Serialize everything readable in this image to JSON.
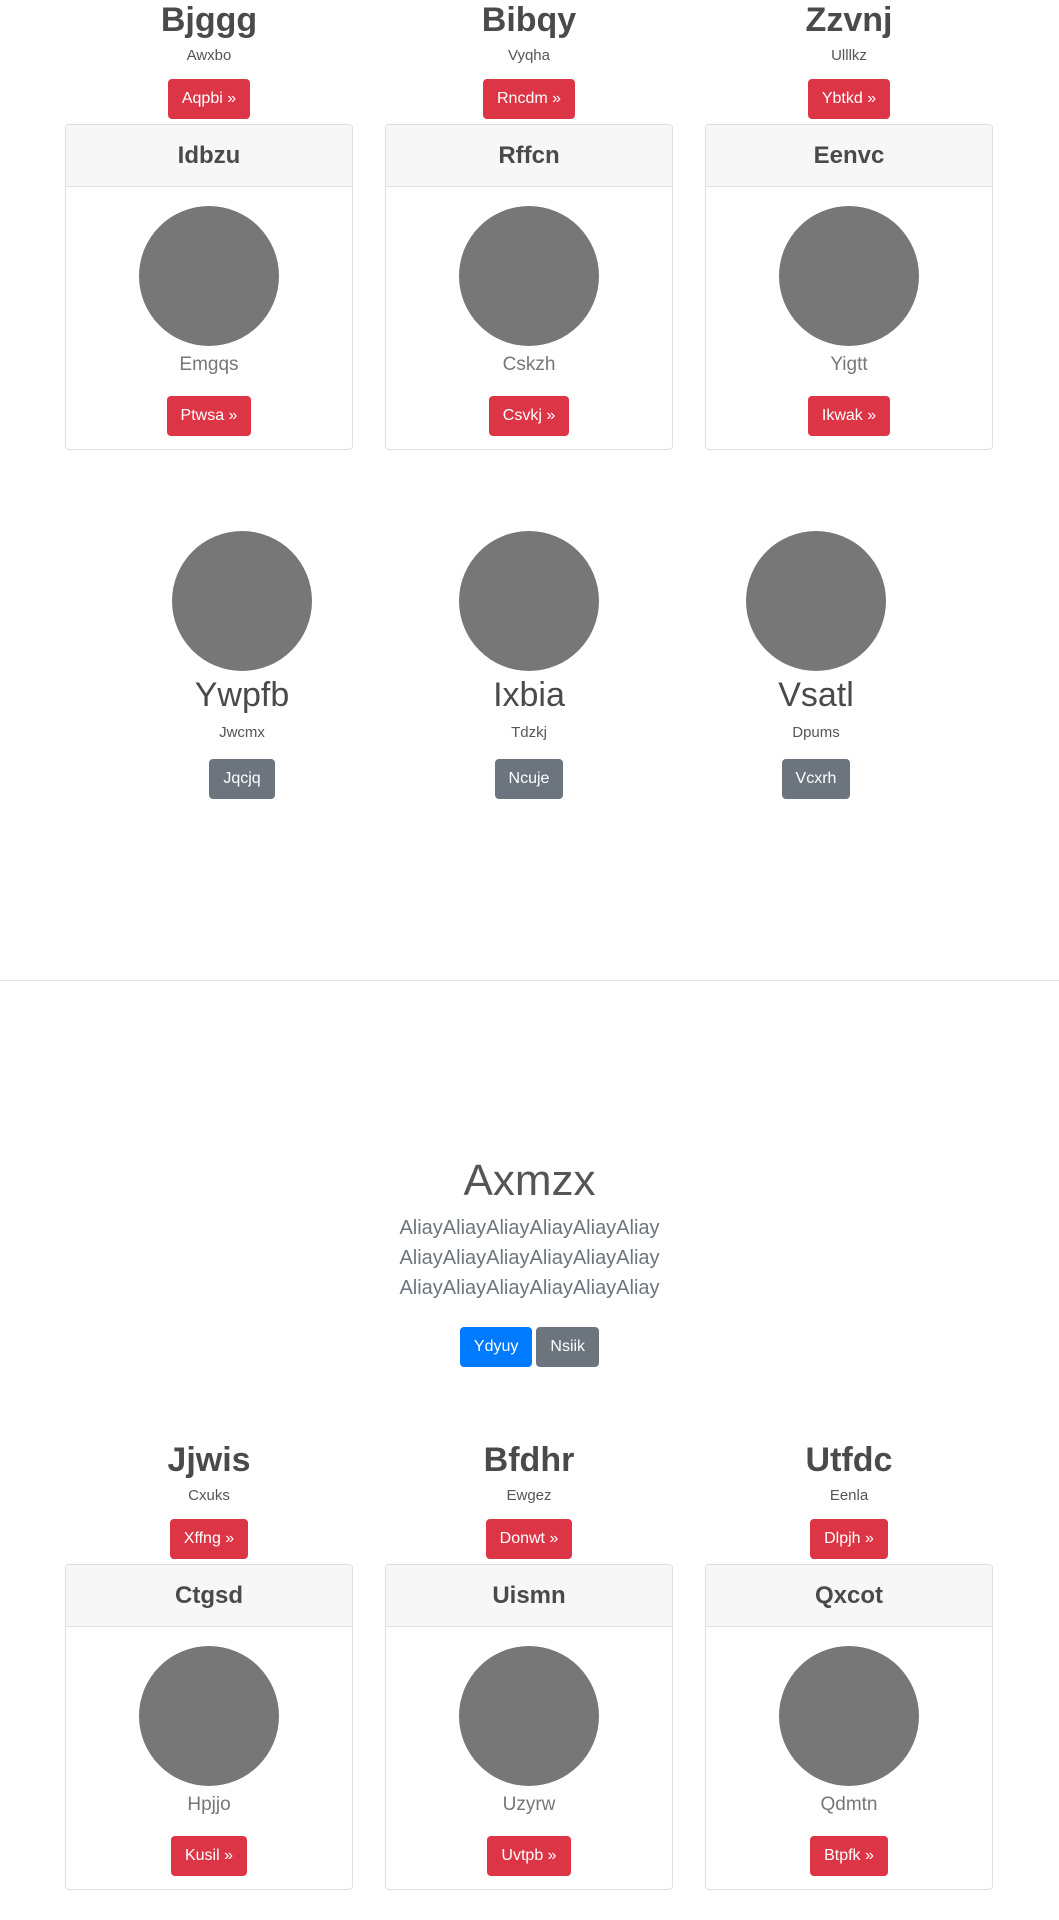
{
  "top_row": [
    {
      "title": "Bjggg",
      "subtitle": "Awxbo",
      "button": "Aqpbi »"
    },
    {
      "title": "Bibqy",
      "subtitle": "Vyqha",
      "button": "Rncdm »"
    },
    {
      "title": "Zzvnj",
      "subtitle": "Ulllkz",
      "button": "Ybtkd »"
    }
  ],
  "cards_1": [
    {
      "header": "Idbzu",
      "name": "Emgqs",
      "button": "Ptwsa »"
    },
    {
      "header": "Rffcn",
      "name": "Cskzh",
      "button": "Csvkj »"
    },
    {
      "header": "Eenvc",
      "name": "Yigtt",
      "button": "Ikwak »"
    }
  ],
  "featurettes": [
    {
      "name": "Ywpfb",
      "subtitle": "Jwcmx",
      "button": "Jqcjq"
    },
    {
      "name": "Ixbia",
      "subtitle": "Tdzkj",
      "button": "Ncuje"
    },
    {
      "name": "Vsatl",
      "subtitle": "Dpums",
      "button": "Vcxrh"
    }
  ],
  "hero": {
    "title": "Axmzx",
    "text": "AliayAliayAliayAliayAliayAliay AliayAliayAliayAliayAliayAliay AliayAliayAliayAliayAliayAliay",
    "primary_button": "Ydyuy",
    "secondary_button": "Nsiik"
  },
  "bottom_row": [
    {
      "title": "Jjwis",
      "subtitle": "Cxuks",
      "button": "Xffng »"
    },
    {
      "title": "Bfdhr",
      "subtitle": "Ewgez",
      "button": "Donwt »"
    },
    {
      "title": "Utfdc",
      "subtitle": "Eenla",
      "button": "Dlpjh »"
    }
  ],
  "cards_2": [
    {
      "header": "Ctgsd",
      "name": "Hpjjo",
      "button": "Kusil »"
    },
    {
      "header": "Uismn",
      "name": "Uzyrw",
      "button": "Uvtpb »"
    },
    {
      "header": "Qxcot",
      "name": "Qdmtn",
      "button": "Btpfk »"
    }
  ],
  "colors": {
    "danger": "#dc3545",
    "secondary": "#6c757d",
    "primary": "#007bff",
    "placeholder": "#777777"
  }
}
